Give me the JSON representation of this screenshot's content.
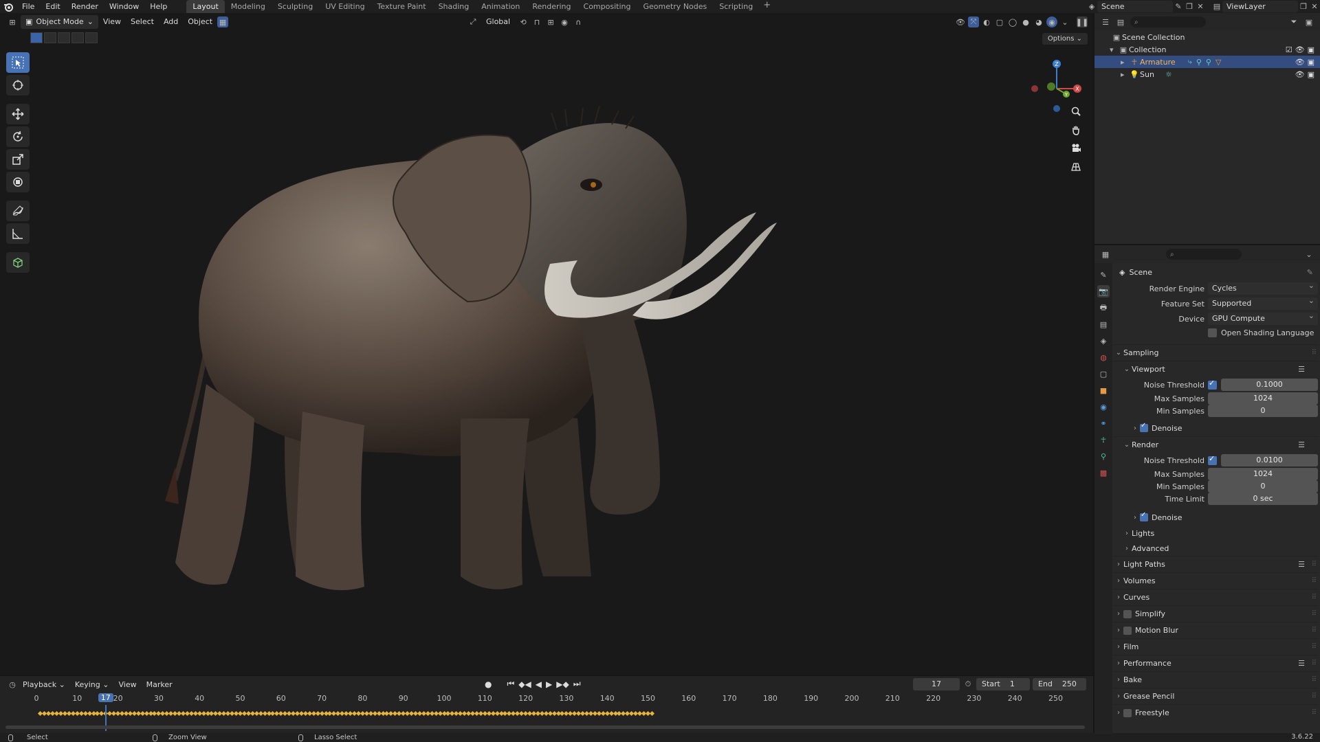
{
  "topbar": {
    "menus": [
      "File",
      "Edit",
      "Render",
      "Window",
      "Help"
    ],
    "workspaces": [
      "Layout",
      "Modeling",
      "Sculpting",
      "UV Editing",
      "Texture Paint",
      "Shading",
      "Animation",
      "Rendering",
      "Compositing",
      "Geometry Nodes",
      "Scripting"
    ],
    "active_workspace": "Layout",
    "scene_name": "Scene",
    "view_layer": "ViewLayer"
  },
  "viewport": {
    "mode": "Object Mode",
    "menus": [
      "View",
      "Select",
      "Add",
      "Object"
    ],
    "transform_orientation": "Global",
    "options_label": "Options",
    "gizmo": {
      "x": "X",
      "y": "Y",
      "z": "Z"
    }
  },
  "timeline": {
    "menus": [
      "Playback",
      "Keying",
      "View",
      "Marker"
    ],
    "current_frame": "17",
    "start_label": "Start",
    "start_value": "1",
    "end_label": "End",
    "end_value": "250",
    "ticks": [
      "0",
      "10",
      "20",
      "30",
      "40",
      "50",
      "60",
      "70",
      "80",
      "90",
      "100",
      "110",
      "120",
      "130",
      "140",
      "150",
      "160",
      "170",
      "180",
      "190",
      "200",
      "210",
      "220",
      "230",
      "240",
      "250"
    ],
    "keyframe_range": [
      1,
      151
    ]
  },
  "statusbar": {
    "select": "Select",
    "zoom_view": "Zoom View",
    "lasso_select": "Lasso Select",
    "version": "3.6.22"
  },
  "outliner": {
    "rows": [
      {
        "label": "Scene Collection"
      },
      {
        "label": "Collection"
      },
      {
        "label": "Armature"
      },
      {
        "label": "Sun"
      }
    ]
  },
  "properties": {
    "context": "Scene",
    "render_engine_label": "Render Engine",
    "render_engine": "Cycles",
    "feature_set_label": "Feature Set",
    "feature_set": "Supported",
    "device_label": "Device",
    "device": "GPU Compute",
    "osl_label": "Open Shading Language",
    "sampling": {
      "title": "Sampling",
      "viewport": {
        "title": "Viewport",
        "noise_threshold_label": "Noise Threshold",
        "noise_threshold": "0.1000",
        "max_samples_label": "Max Samples",
        "max_samples": "1024",
        "min_samples_label": "Min Samples",
        "min_samples": "0",
        "denoise_label": "Denoise"
      },
      "render": {
        "title": "Render",
        "noise_threshold_label": "Noise Threshold",
        "noise_threshold": "0.0100",
        "max_samples_label": "Max Samples",
        "max_samples": "1024",
        "min_samples_label": "Min Samples",
        "min_samples": "0",
        "time_limit_label": "Time Limit",
        "time_limit": "0 sec",
        "denoise_label": "Denoise"
      },
      "lights": "Lights",
      "advanced": "Advanced"
    },
    "panels": [
      "Light Paths",
      "Volumes",
      "Curves",
      "Simplify",
      "Motion Blur",
      "Film",
      "Performance",
      "Bake",
      "Grease Pencil",
      "Freestyle"
    ]
  },
  "colors": {
    "accent": "#4772b3",
    "selected_row": "#334d80",
    "keyframe": "#e6b33b"
  }
}
